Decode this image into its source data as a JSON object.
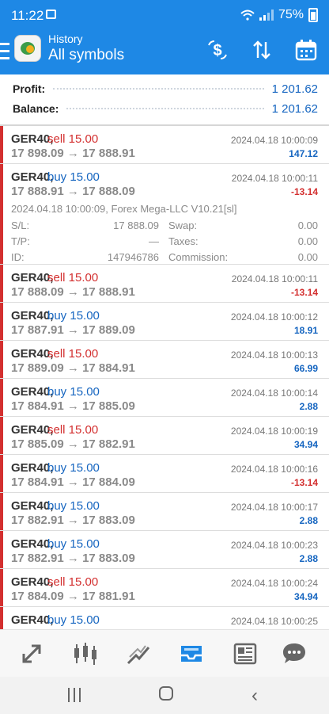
{
  "status_bar": {
    "time": "11:22",
    "battery": "75%",
    "icons": [
      "gallery-icon",
      "wifi-icon",
      "signal-icon",
      "battery-icon"
    ]
  },
  "app_bar": {
    "subtitle": "History",
    "title": "All symbols",
    "actions": [
      "deposit-icon",
      "sort-icon",
      "calendar-icon"
    ]
  },
  "summary": {
    "profit_label": "Profit:",
    "profit_value": "1 201.62",
    "balance_label": "Balance:",
    "balance_value": "1 201.62"
  },
  "deals": [
    {
      "symbol": "GER40,",
      "side": "sell 15.00",
      "direction": "sell",
      "prices": "17 898.09 → 17 888.91",
      "time": "2024.04.18 10:00:09",
      "profit": "147.12",
      "profit_positive": true
    },
    {
      "symbol": "GER40,",
      "side": "buy 15.00",
      "direction": "buy",
      "prices": "17 888.91 → 17 888.09",
      "time": "2024.04.18 10:00:11",
      "profit": "-13.14",
      "profit_positive": false,
      "expanded": true,
      "details": {
        "line": "2024.04.18 10:00:09, Forex Mega-LLC V10.21[sl]",
        "sl_label": "S/L:",
        "sl_value": "17 888.09",
        "swap_label": "Swap:",
        "swap_value": "0.00",
        "tp_label": "T/P:",
        "tp_value": "—",
        "taxes_label": "Taxes:",
        "taxes_value": "0.00",
        "id_label": "ID:",
        "id_value": "147946786",
        "commission_label": "Commission:",
        "commission_value": "0.00"
      }
    },
    {
      "symbol": "GER40,",
      "side": "sell 15.00",
      "direction": "sell",
      "prices": "17 888.09 → 17 888.91",
      "time": "2024.04.18 10:00:11",
      "profit": "-13.14",
      "profit_positive": false
    },
    {
      "symbol": "GER40,",
      "side": "buy 15.00",
      "direction": "buy",
      "prices": "17 887.91 → 17 889.09",
      "time": "2024.04.18 10:00:12",
      "profit": "18.91",
      "profit_positive": true
    },
    {
      "symbol": "GER40,",
      "side": "sell 15.00",
      "direction": "sell",
      "prices": "17 889.09 → 17 884.91",
      "time": "2024.04.18 10:00:13",
      "profit": "66.99",
      "profit_positive": true
    },
    {
      "symbol": "GER40,",
      "side": "buy 15.00",
      "direction": "buy",
      "prices": "17 884.91 → 17 885.09",
      "time": "2024.04.18 10:00:14",
      "profit": "2.88",
      "profit_positive": true
    },
    {
      "symbol": "GER40,",
      "side": "sell 15.00",
      "direction": "sell",
      "prices": "17 885.09 → 17 882.91",
      "time": "2024.04.18 10:00:19",
      "profit": "34.94",
      "profit_positive": true
    },
    {
      "symbol": "GER40,",
      "side": "buy 15.00",
      "direction": "buy",
      "prices": "17 884.91 → 17 884.09",
      "time": "2024.04.18 10:00:16",
      "profit": "-13.14",
      "profit_positive": false
    },
    {
      "symbol": "GER40,",
      "side": "buy 15.00",
      "direction": "buy",
      "prices": "17 882.91 → 17 883.09",
      "time": "2024.04.18 10:00:17",
      "profit": "2.88",
      "profit_positive": true
    },
    {
      "symbol": "GER40,",
      "side": "buy 15.00",
      "direction": "buy",
      "prices": "17 882.91 → 17 883.09",
      "time": "2024.04.18 10:00:23",
      "profit": "2.88",
      "profit_positive": true
    },
    {
      "symbol": "GER40,",
      "side": "sell 15.00",
      "direction": "sell",
      "prices": "17 884.09 → 17 881.91",
      "time": "2024.04.18 10:00:24",
      "profit": "34.94",
      "profit_positive": true
    },
    {
      "symbol": "GER40,",
      "side": "buy 15.00",
      "direction": "buy",
      "prices": "",
      "time": "2024.04.18 10:00:25",
      "profit": "",
      "profit_positive": true
    }
  ],
  "bottom_nav": [
    "quotes-icon",
    "chart-icon",
    "trade-icon",
    "history-icon",
    "news-icon",
    "messages-icon"
  ],
  "active_tab": "history-icon",
  "colors": {
    "accent": "#1e88e5",
    "buy": "#1565c0",
    "sell": "#d32f2f",
    "row_bar": "#d32f2f"
  }
}
